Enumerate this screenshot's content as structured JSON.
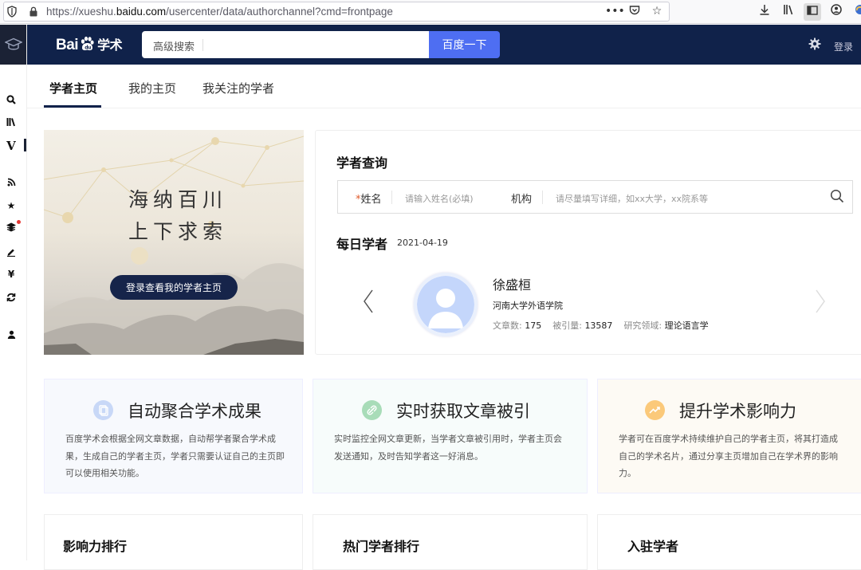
{
  "browser": {
    "url_prefix": "https://xueshu.",
    "url_domain": "baidu.com",
    "url_path": "/usercenter/data/authorchannel?cmd=frontpage",
    "more_label": "•••"
  },
  "header": {
    "logo_text_left": "Bai",
    "logo_text_right": "学术",
    "advanced_search_label": "高级搜索",
    "search_button_label": "百度一下",
    "login_label": "登录"
  },
  "tabs": [
    {
      "label": "学者主页",
      "active": true
    },
    {
      "label": "我的主页",
      "active": false
    },
    {
      "label": "我关注的学者",
      "active": false
    }
  ],
  "banner": {
    "line1": "海纳百川",
    "line2": "上下求索",
    "button_label": "登录查看我的学者主页"
  },
  "scholar_query": {
    "title": "学者查询",
    "name_required_mark": "*",
    "name_label": "姓名",
    "name_placeholder": "请输入姓名(必填)",
    "org_label": "机构",
    "org_placeholder": "请尽量填写详细，如xx大学，xx院系等"
  },
  "daily_scholar": {
    "title": "每日学者",
    "date": "2021-04-19",
    "name": "徐盛桓",
    "organization": "河南大学外语学院",
    "articles_label": "文章数:",
    "articles_value": "175",
    "citations_label": "被引量:",
    "citations_value": "13587",
    "field_label": "研究领域:",
    "field_value": "理论语言学"
  },
  "features": [
    {
      "title": "自动聚合学术成果",
      "desc": "百度学术会根据全网文章数据，自动帮学者聚合学术成果，生成自己的学者主页，学者只需要认证自己的主页即可以使用相关功能。",
      "icon_color": "#c8d8f7"
    },
    {
      "title": "实时获取文章被引",
      "desc": "实时监控全网文章更新，当学者文章被引用时，学者主页会发送通知，及时告知学者这一好消息。",
      "icon_color": "#a8dcb8"
    },
    {
      "title": "提升学术影响力",
      "desc": "学者可在百度学术持续维护自己的学者主页，将其打造成自己的学术名片，通过分享主页增加自己在学术界的影响力。",
      "icon_color": "#fbc97a"
    }
  ],
  "rankings": [
    {
      "title": "影响力排行"
    },
    {
      "title": "热门学者排行"
    },
    {
      "title": "入驻学者"
    }
  ],
  "colors": {
    "header_bg": "#10224a",
    "accent_blue": "#4e6ef2",
    "required_orange": "#e05a2b"
  }
}
